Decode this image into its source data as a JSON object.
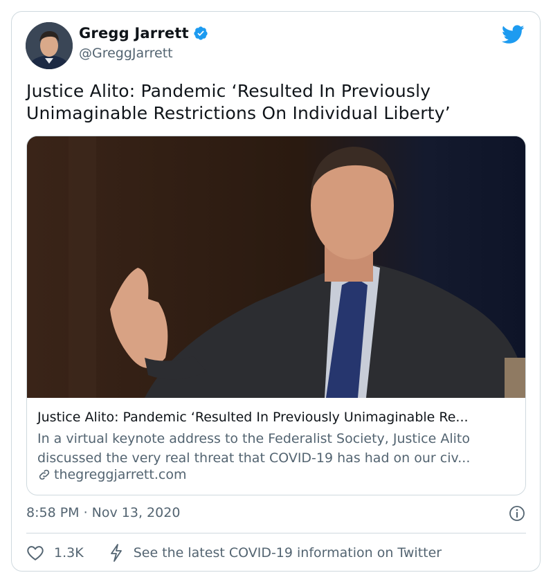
{
  "author": {
    "display_name": "Gregg Jarrett",
    "handle": "@GreggJarrett",
    "verified": true
  },
  "tweet": {
    "text": "Justice Alito: Pandemic ‘Resulted In Previously Unimaginable Restrictions On Individual Liberty’",
    "timestamp": "8:58 PM · Nov 13, 2020"
  },
  "link_card": {
    "title": "Justice Alito: Pandemic ‘Resulted In Previously Unimaginable Re...",
    "description": "In a virtual keynote address to the Federalist Society, Justice Alito discussed the very real threat that COVID-19 has had on our civ...",
    "domain": "thegreggjarrett.com"
  },
  "actions": {
    "like_count": "1.3K",
    "covid_notice": "See the latest COVID-19 information on Twitter"
  },
  "icons": {
    "verified": "verified-badge-icon",
    "brand": "twitter-bird-icon",
    "link": "link-icon",
    "info": "info-icon",
    "like": "heart-icon",
    "covid": "lightning-icon"
  },
  "colors": {
    "twitter_blue": "#1d9bf0",
    "text": "#0f1419",
    "secondary_text": "#536471",
    "border": "#cfd9de"
  }
}
